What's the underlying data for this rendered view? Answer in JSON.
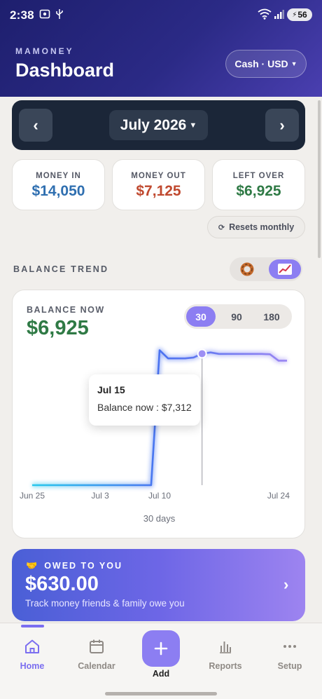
{
  "status_bar": {
    "time": "2:38",
    "battery": "56",
    "icons": [
      "screenshot-icon",
      "usb-icon",
      "wifi-icon",
      "signal-icon"
    ]
  },
  "header": {
    "app_name": "MAMONEY",
    "title": "Dashboard",
    "account_selector": "Cash · USD",
    "gradient": [
      "#1e1f6e",
      "#4a3fb0"
    ]
  },
  "month_nav": {
    "prev": "‹",
    "label": "July 2026",
    "next": "›"
  },
  "stats": [
    {
      "label": "MONEY IN",
      "value": "$14,050",
      "color": "#2f6fb0"
    },
    {
      "label": "MONEY OUT",
      "value": "$7,125",
      "color": "#c0492f"
    },
    {
      "label": "LEFT OVER",
      "value": "$6,925",
      "color": "#2f7a45"
    }
  ],
  "resets_label": "Resets monthly",
  "trend": {
    "section_title": "BALANCE TREND",
    "view_modes": [
      "donut-icon",
      "trend-line-icon"
    ],
    "active_view": "trend-line-icon",
    "balance_label": "BALANCE NOW",
    "balance_value": "$6,925",
    "ranges": [
      "30",
      "90",
      "180"
    ],
    "active_range": "30",
    "tooltip_title": "Jul 15",
    "tooltip_body": "Balance now : $7,312",
    "range_caption": "30 days",
    "accent": "#8c7ef2"
  },
  "chart_data": {
    "type": "line",
    "x_tick_labels": [
      "Jun 25",
      "Jul 3",
      "Jul 10",
      "Jul 24"
    ],
    "x": [
      "Jun 25",
      "Jun 26",
      "Jun 27",
      "Jun 28",
      "Jun 29",
      "Jun 30",
      "Jul 1",
      "Jul 2",
      "Jul 3",
      "Jul 4",
      "Jul 5",
      "Jul 6",
      "Jul 7",
      "Jul 8",
      "Jul 9",
      "Jul 10",
      "Jul 11",
      "Jul 12",
      "Jul 13",
      "Jul 14",
      "Jul 15",
      "Jul 16",
      "Jul 17",
      "Jul 18",
      "Jul 19",
      "Jul 20",
      "Jul 21",
      "Jul 22",
      "Jul 23",
      "Jul 24",
      "Jul 25"
    ],
    "y": [
      0,
      0,
      0,
      0,
      0,
      0,
      0,
      0,
      0,
      0,
      0,
      0,
      0,
      0,
      0,
      7500,
      7050,
      7050,
      7050,
      7100,
      7312,
      7380,
      7300,
      7300,
      7300,
      7300,
      7300,
      7300,
      7280,
      6925,
      6925
    ],
    "highlight_x": "Jul 15",
    "highlight_y": 7312,
    "ylim": [
      0,
      8500
    ],
    "grid": false,
    "legend": "none"
  },
  "owed": {
    "label": "OWED TO YOU",
    "amount": "$630.00",
    "subtitle": "Track money friends & family owe you",
    "chevron": "›"
  },
  "bottom_nav": {
    "items": [
      {
        "label": "Home",
        "icon": "home-icon",
        "active": true
      },
      {
        "label": "Calendar",
        "icon": "calendar-icon",
        "active": false
      },
      {
        "label": "Reports",
        "icon": "bar-chart-icon",
        "active": false
      },
      {
        "label": "Setup",
        "icon": "more-icon",
        "active": false
      }
    ],
    "add_label": "Add"
  }
}
